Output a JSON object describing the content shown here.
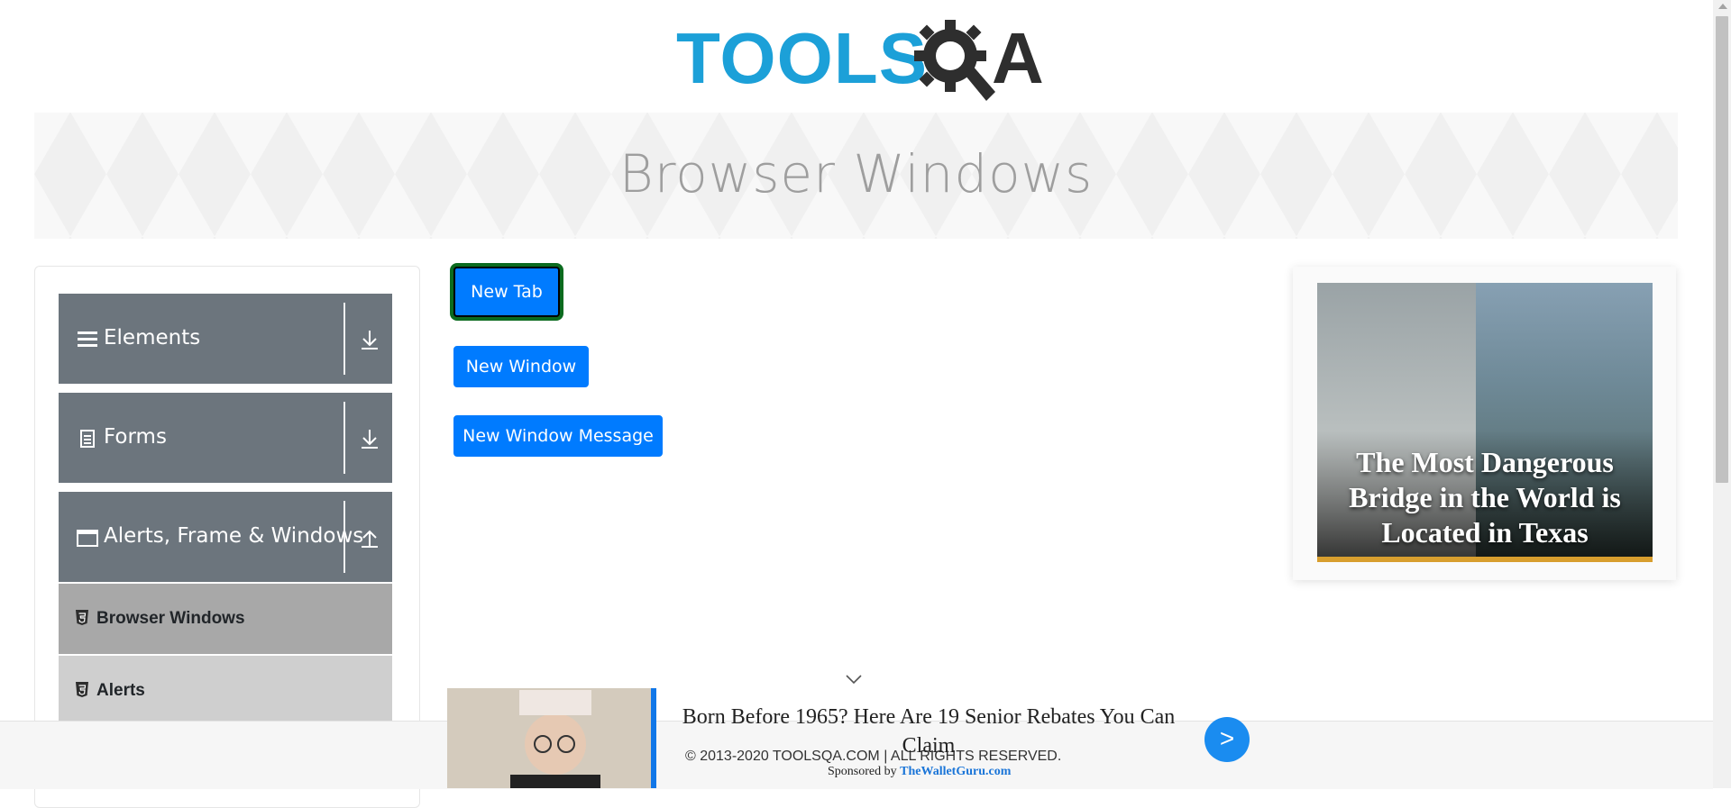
{
  "brand": {
    "logo_text": "TOOLS",
    "logo_q_letter": "Q",
    "logo_a_letter": "A"
  },
  "page": {
    "title": "Browser Windows"
  },
  "sidebar": {
    "groups": [
      {
        "label": "Elements",
        "icon": "hamburger-icon",
        "expanded": false
      },
      {
        "label": "Forms",
        "icon": "document-icon",
        "expanded": false
      },
      {
        "label": "Alerts, Frame & Windows",
        "icon": "window-icon",
        "expanded": true
      }
    ],
    "sub_items": [
      {
        "label": "Browser Windows",
        "icon": "html5-icon",
        "active": true
      },
      {
        "label": "Alerts",
        "icon": "html5-icon",
        "active": false
      }
    ]
  },
  "main": {
    "buttons": [
      {
        "label": "New Tab",
        "focused": true
      },
      {
        "label": "New Window",
        "focused": false
      },
      {
        "label": "New Window Message",
        "focused": false
      }
    ]
  },
  "ad_side": {
    "caption": "The Most Dangerous Bridge in the World is Located in Texas"
  },
  "bottom_ad": {
    "headline": "Born Before 1965? Here Are 19 Senior Rebates You Can Claim",
    "go_label": ">",
    "sponsor_prefix": "Sponsored by",
    "sponsor_name": "TheWalletGuru.com"
  },
  "footer": {
    "copyright": "© 2013-2020 TOOLSQA.COM | ALL RIGHTS RESERVED."
  },
  "colors": {
    "primary": "#007bff",
    "sidebar_group": "#6c757d",
    "active_sub": "#a8a8a8",
    "sub": "#cfcfcf",
    "logo_blue": "#1ca0d8"
  }
}
